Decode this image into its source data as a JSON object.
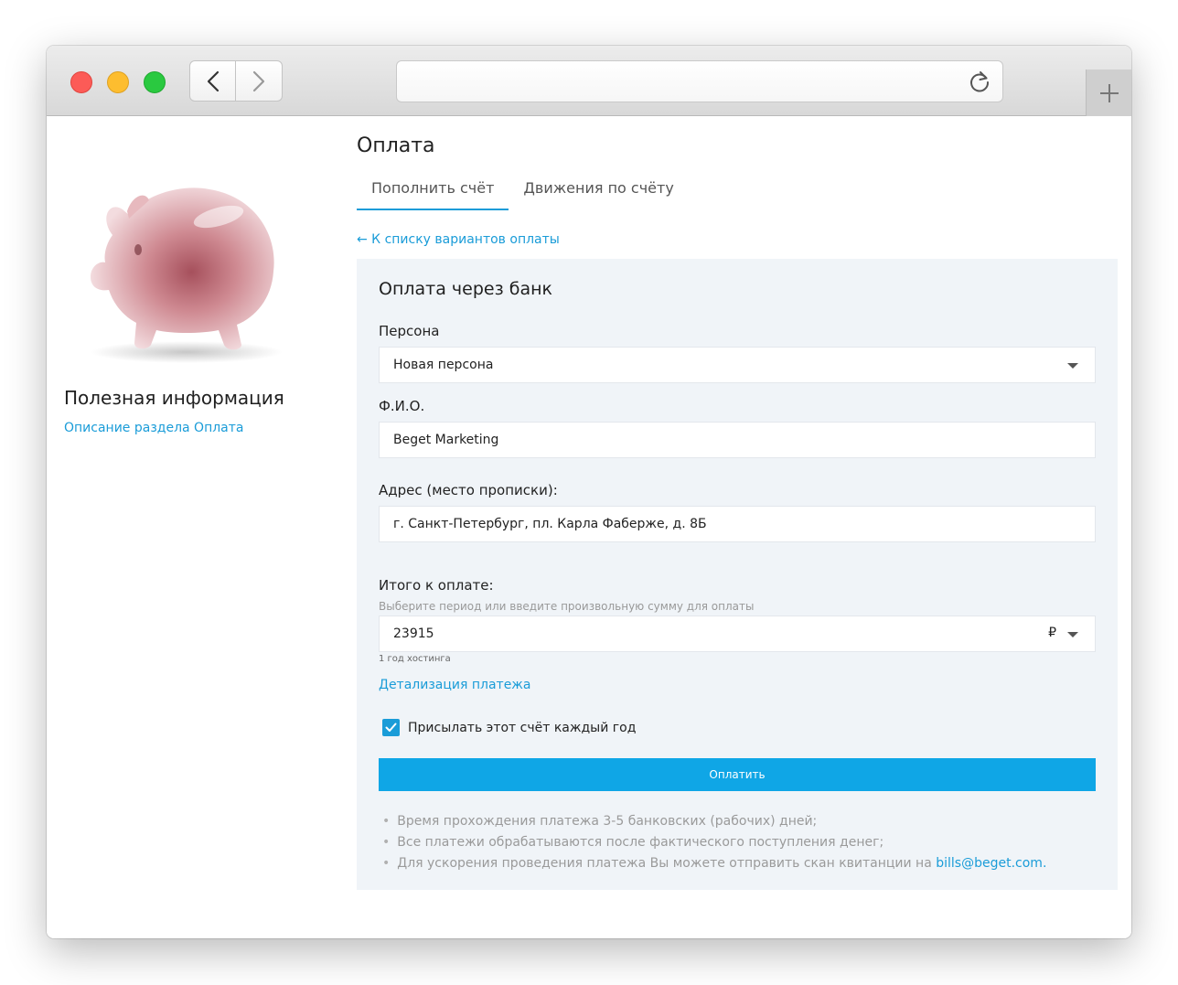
{
  "sidebar": {
    "title": "Полезная информация",
    "link": "Описание раздела Оплата"
  },
  "main": {
    "title": "Оплата",
    "tabs": [
      {
        "label": "Пополнить счёт",
        "active": true
      },
      {
        "label": "Движения по счёту",
        "active": false
      }
    ],
    "back_link": "← К списку вариантов оплаты"
  },
  "form": {
    "title": "Оплата через банк",
    "persona_label": "Персона",
    "persona_value": "Новая персона",
    "fio_label": "Ф.И.О.",
    "fio_value": "Beget Marketing",
    "address_label": "Адрес (место прописки):",
    "address_value": "г. Санкт-Петербург, пл. Карла Фаберже, д. 8Б",
    "total_label": "Итого к оплате:",
    "total_hint": "Выберите период или введите произвольную сумму для оплаты",
    "total_value": "23915",
    "currency": "₽",
    "total_note": "1 год хостинга",
    "detail_link": "Детализация платежа",
    "checkbox_label": "Присылать этот счёт каждый год",
    "checkbox_checked": true,
    "pay_button": "Оплатить"
  },
  "notes": [
    "Время прохождения платежа 3-5 банковских (рабочих) дней;",
    "Все платежи обрабатываются после фактического поступления денег;"
  ],
  "note_last": {
    "text": "Для ускорения проведения платежа Вы можете отправить скан квитанции на ",
    "email": "bills@beget.com",
    "end": "."
  },
  "colors": {
    "accent": "#1a9cd8",
    "button": "#0fa6e6",
    "panel_bg": "#f0f4f8"
  },
  "icons": [
    "back-arrow-icon",
    "forward-arrow-icon",
    "reload-icon",
    "plus-icon",
    "piggy-bank-icon",
    "caret-down-icon",
    "check-icon"
  ]
}
